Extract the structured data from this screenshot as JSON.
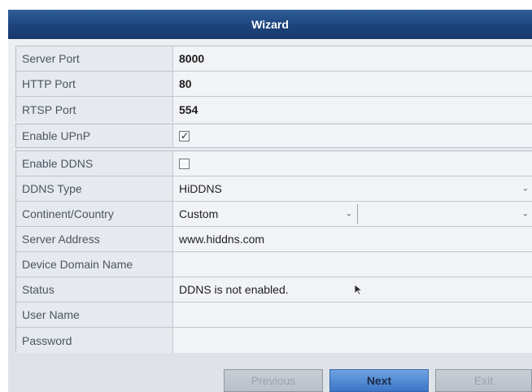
{
  "window": {
    "title": "Wizard"
  },
  "ports": [
    {
      "label": "Server Port",
      "value": "8000"
    },
    {
      "label": "HTTP Port",
      "value": "80"
    },
    {
      "label": "RTSP Port",
      "value": "554"
    }
  ],
  "upnp": {
    "label": "Enable UPnP",
    "checked": true,
    "check_glyph": "✓"
  },
  "ddns": {
    "enable_label": "Enable DDNS",
    "enabled": false,
    "type_label": "DDNS Type",
    "type_value": "HiDDNS",
    "country_label": "Continent/Country",
    "country_value": "Custom",
    "country_secondary_value": "",
    "server_label": "Server Address",
    "server_value": "www.hiddns.com",
    "domain_label": "Device Domain Name",
    "domain_value": "",
    "status_label": "Status",
    "status_value": "DDNS is not enabled.",
    "username_label": "User Name",
    "username_value": "",
    "password_label": "Password",
    "password_value": ""
  },
  "buttons": {
    "previous": "Previous",
    "next": "Next",
    "exit": "Exit"
  },
  "icons": {
    "dropdown": "chevron-down-icon",
    "checkbox": "check-icon",
    "pointer": "mouse-pointer-icon"
  }
}
